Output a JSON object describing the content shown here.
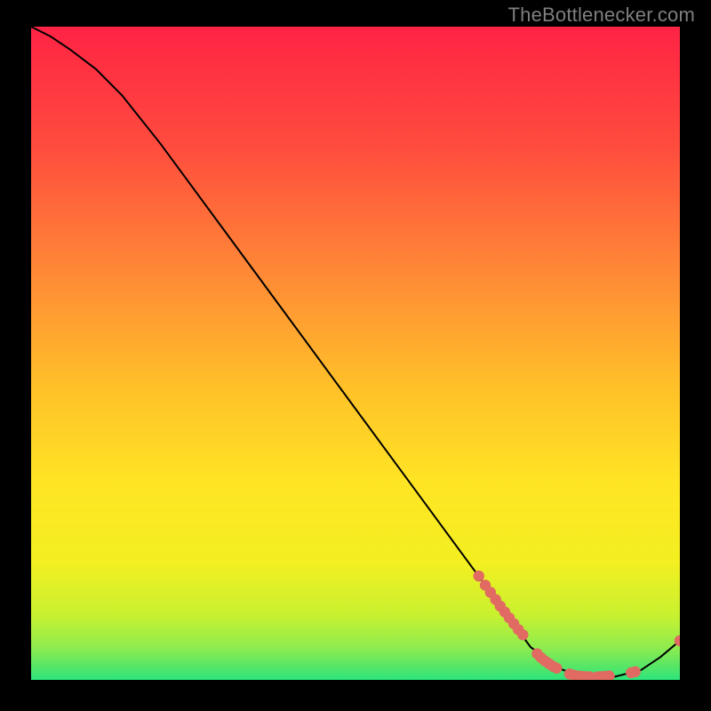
{
  "watermark": "TheBottlenecker.com",
  "chart_data": {
    "type": "line",
    "title": "",
    "xlabel": "",
    "ylabel": "",
    "xlim": [
      0,
      100
    ],
    "ylim": [
      0,
      100
    ],
    "background_gradient": {
      "top": "#ff2344",
      "mid_upper": "#ff8138",
      "mid": "#ffe524",
      "mid_lower": "#d2f22a",
      "bottom": "#2ce57b"
    },
    "series": [
      {
        "name": "curve",
        "type": "line",
        "color": "#000000",
        "x": [
          0,
          3,
          6,
          10,
          14,
          20,
          30,
          40,
          50,
          60,
          70,
          77,
          82,
          86,
          90,
          94,
          97,
          100
        ],
        "y": [
          100,
          98.5,
          96.5,
          93.5,
          89.5,
          82,
          68.5,
          55,
          41.5,
          28,
          14.5,
          5,
          1.5,
          0.5,
          0.5,
          1.5,
          3.5,
          6
        ]
      },
      {
        "name": "points-upper",
        "type": "scatter",
        "color": "#e16b62",
        "x": [
          69.0,
          70.0,
          70.8,
          71.6,
          72.3,
          73.0,
          73.7,
          74.4,
          75.1,
          75.8
        ],
        "y": [
          15.9,
          14.5,
          13.4,
          12.3,
          11.3,
          10.4,
          9.5,
          8.6,
          7.7,
          6.9
        ]
      },
      {
        "name": "points-mid",
        "type": "scatter",
        "color": "#e16b62",
        "x": [
          78.0,
          78.6,
          79.2,
          79.8,
          80.4,
          81.0
        ],
        "y": [
          4.0,
          3.4,
          2.9,
          2.5,
          2.1,
          1.8
        ]
      },
      {
        "name": "points-bottom",
        "type": "scatter",
        "color": "#e16b62",
        "x": [
          83.0,
          83.7,
          84.3,
          84.9,
          85.5,
          86.1,
          87.3,
          87.9,
          88.5,
          89.1,
          92.5,
          93.1,
          100.0
        ],
        "y": [
          0.9,
          0.7,
          0.6,
          0.55,
          0.5,
          0.48,
          0.47,
          0.5,
          0.55,
          0.6,
          1.1,
          1.25,
          6.0
        ]
      }
    ]
  }
}
